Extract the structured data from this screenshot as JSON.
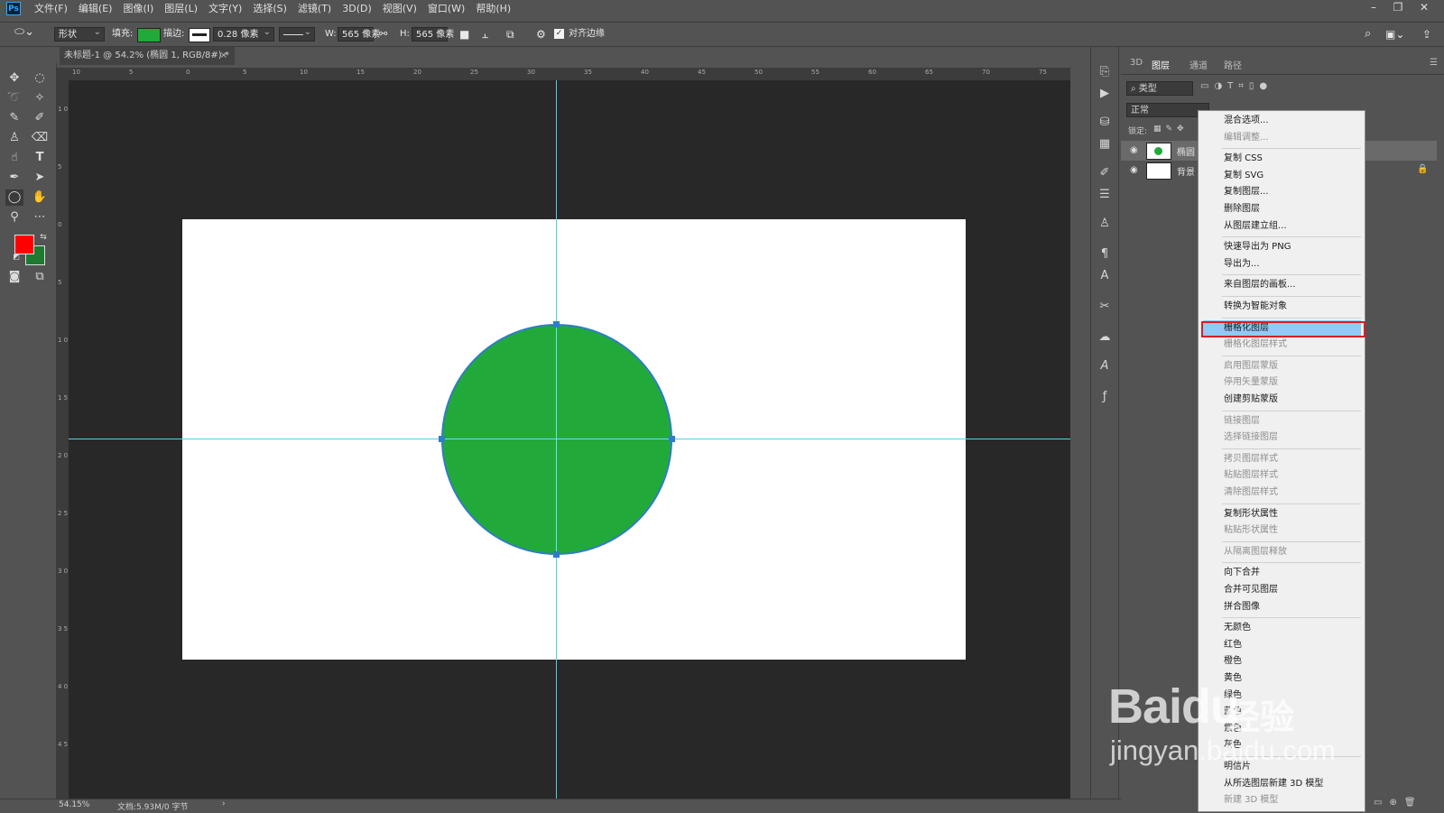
{
  "menubar": {
    "logo": "Ps",
    "items": [
      "文件(F)",
      "编辑(E)",
      "图像(I)",
      "图层(L)",
      "文字(Y)",
      "选择(S)",
      "滤镜(T)",
      "3D(D)",
      "视图(V)",
      "窗口(W)",
      "帮助(H)"
    ],
    "controls": {
      "minimize": "–",
      "restore": "❐",
      "close": "✕"
    }
  },
  "options_bar": {
    "mode": "形状",
    "fill_label": "填充:",
    "fill_color": "#21aa3a",
    "stroke_label": "描边:",
    "stroke_width": "0.28 像素",
    "w_label": "W:",
    "w_value": "565 像素",
    "h_label": "H:",
    "h_value": "565 像素",
    "align_edges_label": "对齐边缘"
  },
  "document": {
    "tab_title": "未标题-1 @ 54.2% (椭圆 1, RGB/8#) *",
    "tab_close": "×",
    "ruler_top": [
      "10",
      "5",
      "0",
      "5",
      "10",
      "15",
      "20",
      "25",
      "30",
      "35",
      "40",
      "45",
      "50",
      "55",
      "60",
      "65",
      "70",
      "75"
    ],
    "ruler_left": [
      "1 0",
      "5",
      "0",
      "5",
      "1 0",
      "1 5",
      "2 0",
      "2 5",
      "3 0",
      "3 5",
      "4 0",
      "4 5"
    ]
  },
  "tools": {
    "foreground_color": "#ff0000",
    "background_color": "#1e7a2f"
  },
  "status": {
    "zoom": "54.15%",
    "doc_info": "文档:5.93M/0 字节",
    "arrow": "›"
  },
  "layers_panel": {
    "tabs": [
      "3D",
      "图层",
      "通道",
      "路径"
    ],
    "active_tab": "图层",
    "filter_kind": "类型",
    "blend_mode": "正常",
    "lock_label": "锁定:",
    "layers": [
      {
        "name": "椭圆",
        "visible": true,
        "selected": true
      },
      {
        "name": "背景",
        "visible": true,
        "selected": false,
        "locked": true
      }
    ]
  },
  "context_menu": {
    "highlighted": "栅格化图层",
    "items": [
      {
        "label": "混合选项...",
        "disabled": false
      },
      {
        "label": "编辑调整...",
        "disabled": true
      },
      {
        "sep": true
      },
      {
        "label": "复制 CSS",
        "disabled": false
      },
      {
        "label": "复制 SVG",
        "disabled": false
      },
      {
        "label": "复制图层...",
        "disabled": false
      },
      {
        "label": "删除图层",
        "disabled": false
      },
      {
        "label": "从图层建立组...",
        "disabled": false
      },
      {
        "sep": true
      },
      {
        "label": "快速导出为 PNG",
        "disabled": false
      },
      {
        "label": "导出为...",
        "disabled": false
      },
      {
        "sep": true
      },
      {
        "label": "来自图层的画板...",
        "disabled": false
      },
      {
        "sep": true
      },
      {
        "label": "转换为智能对象",
        "disabled": false
      },
      {
        "sep": true
      },
      {
        "label": "栅格化图层",
        "disabled": false,
        "highlight": true
      },
      {
        "label": "栅格化图层样式",
        "disabled": true
      },
      {
        "sep": true
      },
      {
        "label": "启用图层蒙版",
        "disabled": true
      },
      {
        "label": "停用矢量蒙版",
        "disabled": true
      },
      {
        "label": "创建剪贴蒙版",
        "disabled": false
      },
      {
        "sep": true
      },
      {
        "label": "链接图层",
        "disabled": true
      },
      {
        "label": "选择链接图层",
        "disabled": true
      },
      {
        "sep": true
      },
      {
        "label": "拷贝图层样式",
        "disabled": true
      },
      {
        "label": "粘贴图层样式",
        "disabled": true
      },
      {
        "label": "清除图层样式",
        "disabled": true
      },
      {
        "sep": true
      },
      {
        "label": "复制形状属性",
        "disabled": false
      },
      {
        "label": "粘贴形状属性",
        "disabled": true
      },
      {
        "sep": true
      },
      {
        "label": "从隔离图层释放",
        "disabled": true
      },
      {
        "sep": true
      },
      {
        "label": "向下合并",
        "disabled": false
      },
      {
        "label": "合并可见图层",
        "disabled": false
      },
      {
        "label": "拼合图像",
        "disabled": false
      },
      {
        "sep": true
      },
      {
        "label": "无颜色",
        "disabled": false
      },
      {
        "label": "红色",
        "disabled": false
      },
      {
        "label": "橙色",
        "disabled": false
      },
      {
        "label": "黄色",
        "disabled": false
      },
      {
        "label": "绿色",
        "disabled": false
      },
      {
        "label": "蓝色",
        "disabled": false
      },
      {
        "label": "紫色",
        "disabled": false
      },
      {
        "label": "灰色",
        "disabled": false
      },
      {
        "sep": true
      },
      {
        "label": "明信片",
        "disabled": false
      },
      {
        "label": "从所选图层新建 3D 模型",
        "disabled": false
      },
      {
        "label": "新建 3D 模型",
        "disabled": true
      }
    ]
  },
  "watermark": {
    "brand": "Bai",
    "paw": "du",
    "product": "经验",
    "url": "jingyan.baidu.com"
  }
}
